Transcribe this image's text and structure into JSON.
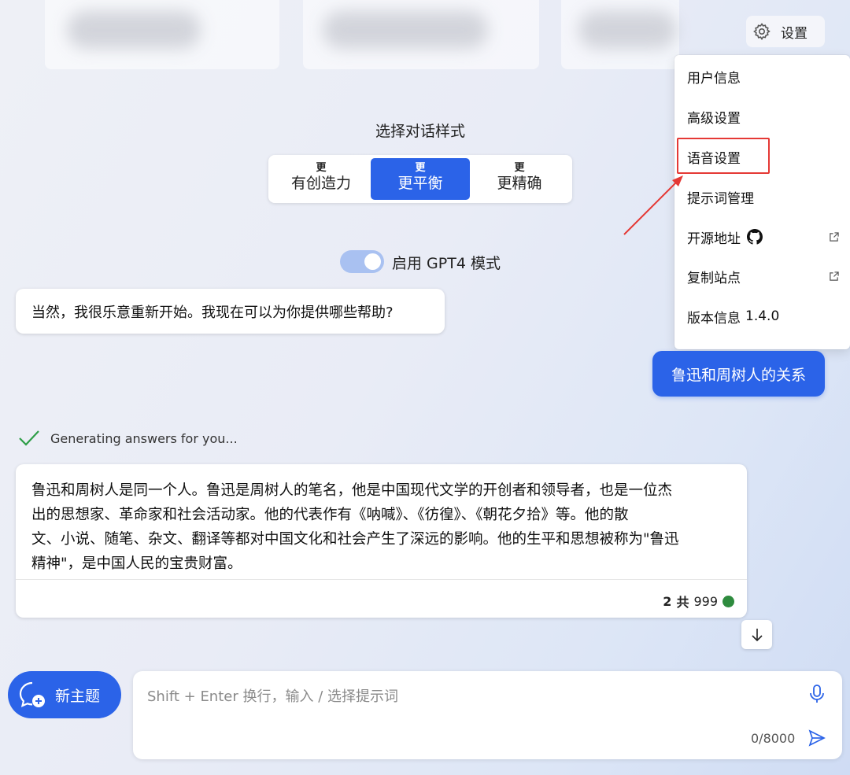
{
  "header": {
    "settings_label": "设置"
  },
  "settings_menu": {
    "items": [
      {
        "label": "用户信息"
      },
      {
        "label": "高级设置"
      },
      {
        "label": "语音设置"
      },
      {
        "label": "提示词管理"
      },
      {
        "label": "开源地址"
      },
      {
        "label": "复制站点"
      },
      {
        "label": "版本信息",
        "version": "1.4.0"
      }
    ],
    "highlighted": "语音设置",
    "annotation_color": "#e53935"
  },
  "conversation_style": {
    "title": "选择对话样式",
    "options": [
      {
        "prefix": "更",
        "label": "有创造力",
        "selected": false
      },
      {
        "prefix": "更",
        "label": "更平衡",
        "selected": true
      },
      {
        "prefix": "更",
        "label": "更精确",
        "selected": false
      }
    ]
  },
  "gpt4_toggle": {
    "label": "启用 GPT4 模式",
    "enabled": true
  },
  "messages": {
    "bot_greeting": "当然，我很乐意重新开始。我现在可以为你提供哪些帮助?",
    "user_message": "鲁迅和周树人的关系",
    "status": "Generating answers for you...",
    "answer_lines": [
      "鲁迅和周树人是同一个人。鲁迅是周树人的笔名，他是中国现代文学的开创者和领导者，也是一位杰",
      "出的思想家、革命家和社会活动家。他的代表作有《呐喊》、《彷徨》、《朝花夕拾》等。他的散",
      "文、小说、随笔、杂文、翻译等都对中国文化和社会产生了深远的影响。他的生平和思想被称为\"鲁迅",
      "精神\"，是中国人民的宝贵财富。"
    ],
    "answer_count": "2",
    "answer_of": "共",
    "answer_total": "999",
    "status_color": "#2e8b3e"
  },
  "composer": {
    "new_topic_label": "新主题",
    "placeholder": "Shift + Enter 换行，输入 / 选择提示词",
    "value": "",
    "char_counter": "0/8000"
  },
  "colors": {
    "accent": "#2b63e8",
    "toggle_track": "#a9c1f1"
  },
  "icons": [
    "gear-icon",
    "github-icon",
    "external-link-icon",
    "check-icon",
    "arrow-down-icon",
    "new-chat-icon",
    "mic-icon",
    "send-icon"
  ]
}
